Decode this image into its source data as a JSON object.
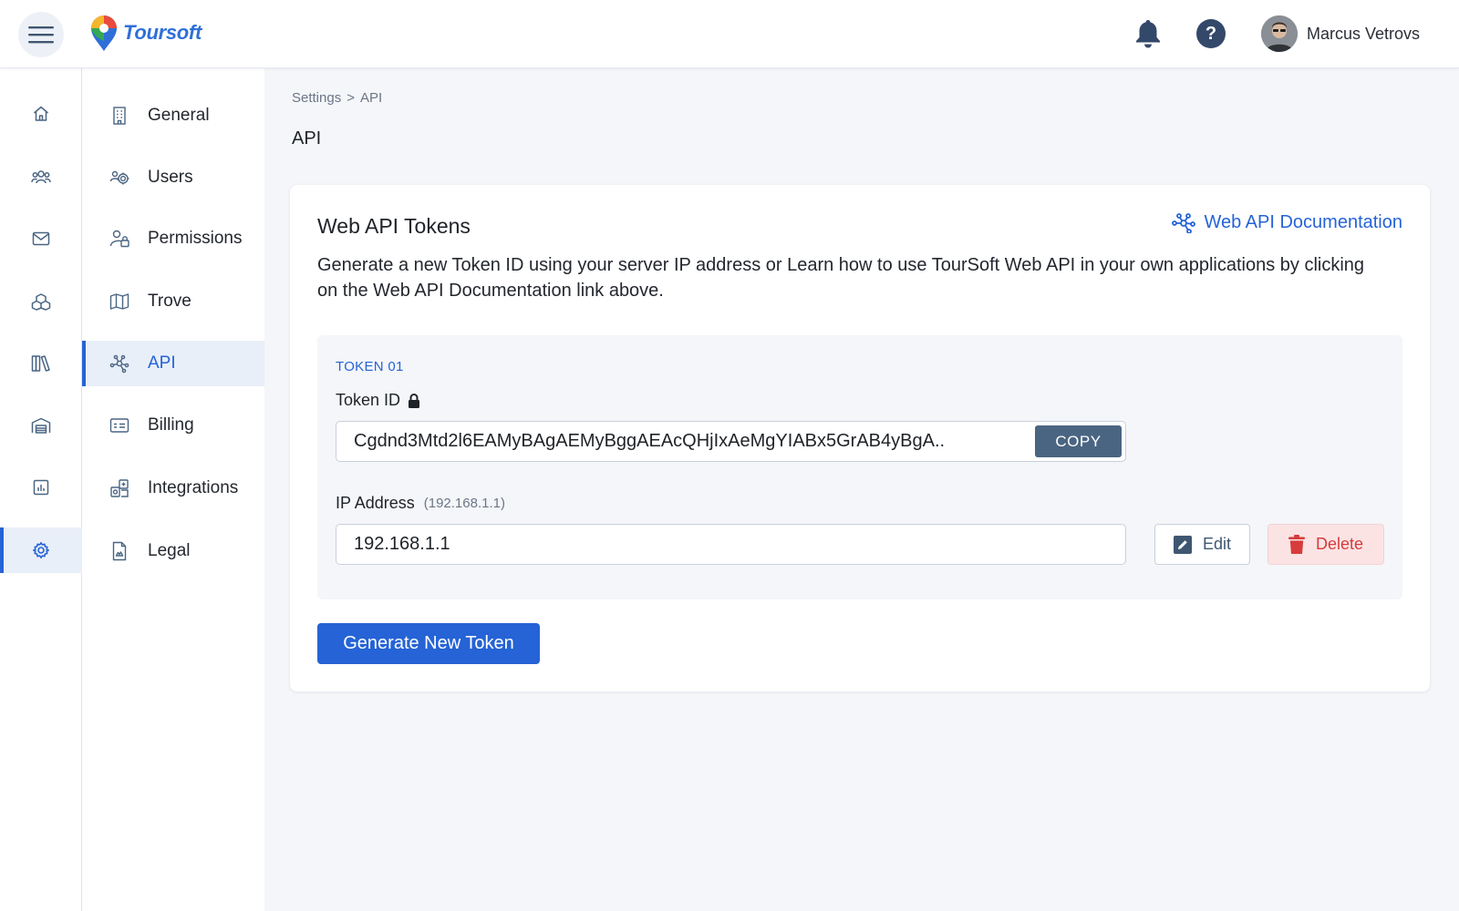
{
  "app": {
    "brand": "Toursoft"
  },
  "header": {
    "user_name": "Marcus Vetrovs",
    "help_glyph": "?"
  },
  "rail": {
    "items": [
      {
        "icon": "home-icon"
      },
      {
        "icon": "users-icon"
      },
      {
        "icon": "mail-icon"
      },
      {
        "icon": "map-icon"
      },
      {
        "icon": "library-icon"
      },
      {
        "icon": "warehouse-icon"
      },
      {
        "icon": "report-icon"
      },
      {
        "icon": "settings-icon",
        "active": true
      }
    ]
  },
  "settings_nav": {
    "items": [
      {
        "label": "General",
        "icon": "building-icon"
      },
      {
        "label": "Users",
        "icon": "users-gear-icon"
      },
      {
        "label": "Permissions",
        "icon": "user-lock-icon"
      },
      {
        "label": "Trove",
        "icon": "map-icon"
      },
      {
        "label": "API",
        "icon": "api-nodes-icon",
        "active": true
      },
      {
        "label": "Billing",
        "icon": "billing-card-icon"
      },
      {
        "label": "Integrations",
        "icon": "integrations-icon"
      },
      {
        "label": "Legal",
        "icon": "document-icon"
      }
    ]
  },
  "breadcrumb": {
    "parent": "Settings",
    "separator": ">",
    "current": "API"
  },
  "page": {
    "title": "API"
  },
  "card": {
    "title": "Web API Tokens",
    "doc_link": "Web API Documentation",
    "description": "Generate a new Token ID using your server IP address or Learn how to use TourSoft Web API in your own applications by clicking on the Web API Documentation link above."
  },
  "token": {
    "label": "TOKEN 01",
    "token_id_label": "Token ID",
    "token_id_value": "Cgdnd3Mtd2l6EAMyBAgAEMyBggAEAcQHjIxAeMgYIABx5GrAB4yBgA..",
    "copy_label": "COPY",
    "ip_label": "IP Address",
    "ip_hint": "(192.168.1.1)",
    "ip_value": "192.168.1.1",
    "edit_label": "Edit",
    "delete_label": "Delete"
  },
  "actions": {
    "generate_label": "Generate New Token"
  },
  "colors": {
    "accent": "#2563d6",
    "copy_button": "#4a6582",
    "delete_text": "#d63c3c",
    "delete_bg": "#fbe3e4",
    "page_bg": "#f4f6f9"
  }
}
